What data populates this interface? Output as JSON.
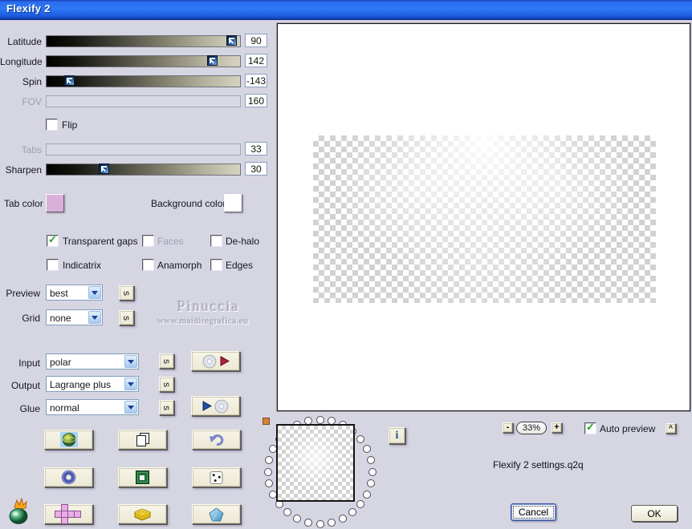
{
  "window": {
    "title": "Flexify 2"
  },
  "glyphs": {
    "check": "✓",
    "s": "s",
    "info": "i",
    "caret": "^",
    "minus": "-",
    "plus": "+"
  },
  "sliders": {
    "latitude": {
      "label": "Latitude",
      "value": "90"
    },
    "longitude": {
      "label": "Longitude",
      "value": "142"
    },
    "spin": {
      "label": "Spin",
      "value": "-143"
    },
    "fov": {
      "label": "FOV",
      "value": "160"
    },
    "tabs": {
      "label": "Tabs",
      "value": "33"
    },
    "sharpen": {
      "label": "Sharpen",
      "value": "30"
    }
  },
  "flip": {
    "label": "Flip"
  },
  "colors": {
    "tab_color_label": "Tab color",
    "tab_color": "#d9b0d9",
    "background_color_label": "Background color",
    "background_color": "#ffffff"
  },
  "checkboxes": {
    "transparent_gaps": {
      "label": "Transparent gaps"
    },
    "faces": {
      "label": "Faces"
    },
    "de_halo": {
      "label": "De-halo"
    },
    "indicatrix": {
      "label": "Indicatrix"
    },
    "anamorph": {
      "label": "Anamorph"
    },
    "edges": {
      "label": "Edges"
    }
  },
  "dropdowns": {
    "preview": {
      "label": "Preview",
      "value": "best"
    },
    "grid": {
      "label": "Grid",
      "value": "none"
    },
    "input": {
      "label": "Input",
      "value": "polar"
    },
    "output": {
      "label": "Output",
      "value": "Lagrange plus"
    },
    "glue": {
      "label": "Glue",
      "value": "normal"
    }
  },
  "watermark": {
    "line1": "Pinuccia",
    "line2": "www.maidiregrafica.eu"
  },
  "zoom_controls": {
    "zoom_value": "33%",
    "auto_preview_label": "Auto preview"
  },
  "footer": {
    "settings_file": "Flexify 2 settings.q2q",
    "cancel_label": "Cancel",
    "ok_label": "OK"
  }
}
